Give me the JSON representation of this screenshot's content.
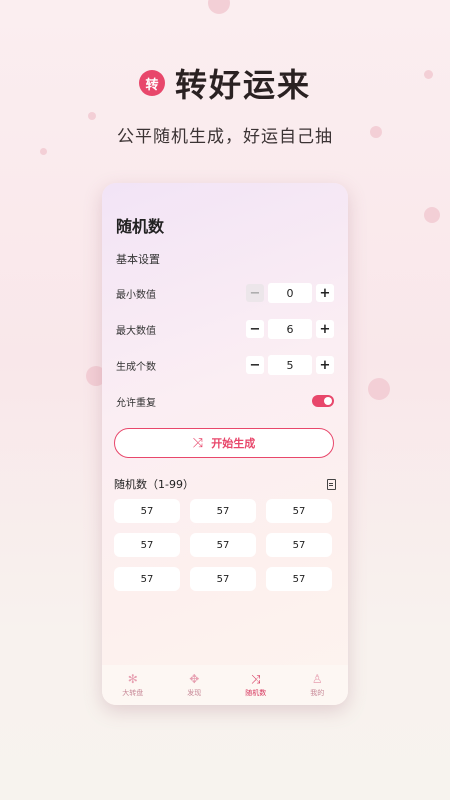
{
  "header": {
    "logo_char": "转",
    "title": "转好运来",
    "subtitle": "公平随机生成，好运自己抽"
  },
  "app": {
    "title": "随机数",
    "section_label": "基本设置",
    "settings": [
      {
        "label": "最小数值",
        "value": "0",
        "minus": "−",
        "plus": "+"
      },
      {
        "label": "最大数值",
        "value": "6",
        "minus": "−",
        "plus": "+"
      },
      {
        "label": "生成个数",
        "value": "5",
        "minus": "−",
        "plus": "+"
      }
    ],
    "allow_repeat_label": "允许重复",
    "allow_repeat": true,
    "start_button_label": "开始生成",
    "results_title": "随机数（1-99）",
    "results": [
      "57",
      "57",
      "57",
      "57",
      "57",
      "57",
      "57",
      "57",
      "57"
    ]
  },
  "tabs": [
    {
      "label": "大转盘",
      "icon": "wheel-icon",
      "glyph": "✻"
    },
    {
      "label": "发现",
      "icon": "discover-icon",
      "glyph": "✥"
    },
    {
      "label": "随机数",
      "icon": "shuffle-icon",
      "glyph": "⤨"
    },
    {
      "label": "我的",
      "icon": "user-icon",
      "glyph": "♙"
    }
  ],
  "colors": {
    "accent": "#e8476b",
    "tab_active": "#d6355d"
  }
}
